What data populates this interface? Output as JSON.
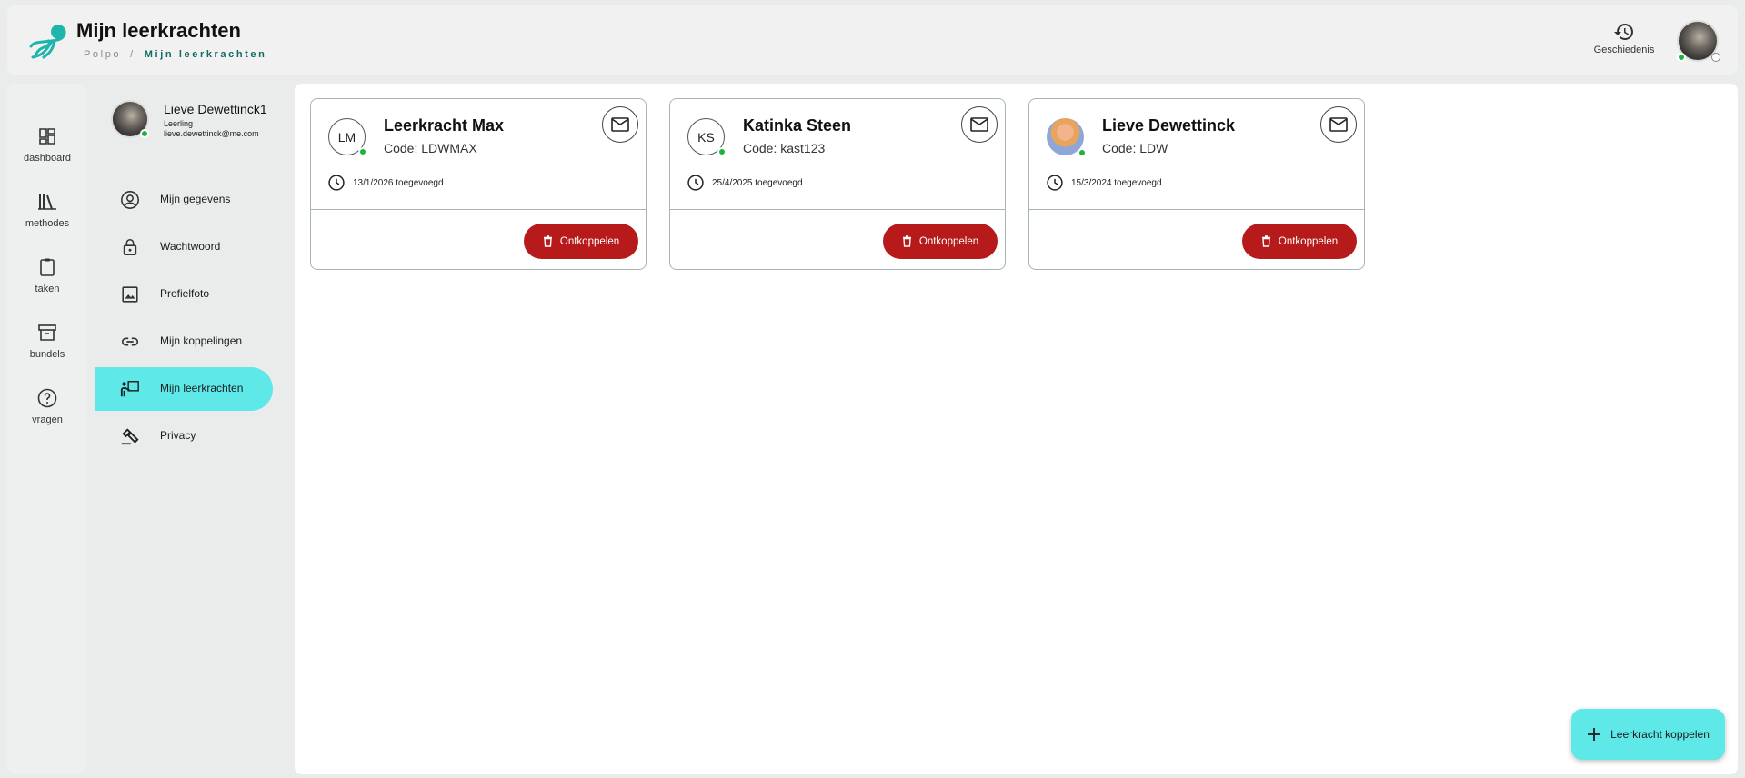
{
  "header": {
    "title": "Mijn leerkrachten",
    "breadcrumb": {
      "root": "Polpo",
      "separator": "/",
      "current": "Mijn leerkrachten"
    },
    "history_label": "Geschiedenis"
  },
  "rail": {
    "items": [
      {
        "label": "dashboard",
        "icon": "dashboard-icon"
      },
      {
        "label": "methodes",
        "icon": "books-icon"
      },
      {
        "label": "taken",
        "icon": "clipboard-icon"
      },
      {
        "label": "bundels",
        "icon": "archive-icon"
      },
      {
        "label": "vragen",
        "icon": "help-icon"
      }
    ]
  },
  "profile": {
    "name": "Lieve Dewettinck1",
    "role": "Leerling",
    "email": "lieve.dewettinck@me.com"
  },
  "menu": {
    "items": [
      {
        "label": "Mijn gegevens",
        "icon": "account-circle-icon"
      },
      {
        "label": "Wachtwoord",
        "icon": "lock-icon"
      },
      {
        "label": "Profielfoto",
        "icon": "image-icon"
      },
      {
        "label": "Mijn koppelingen",
        "icon": "link-icon"
      },
      {
        "label": "Mijn leerkrachten",
        "icon": "teacher-icon",
        "active": true
      },
      {
        "label": "Privacy",
        "icon": "gavel-icon"
      }
    ]
  },
  "teachers": [
    {
      "initials": "LM",
      "name": "Leerkracht Max",
      "code": "Code: LDWMAX",
      "added": "13/1/2026 toegevoegd",
      "unlink_label": "Ontkoppelen"
    },
    {
      "initials": "KS",
      "name": "Katinka Steen",
      "code": "Code: kast123",
      "added": "25/4/2025 toegevoegd",
      "unlink_label": "Ontkoppelen"
    },
    {
      "initials": "",
      "name": "Lieve Dewettinck",
      "code": "Code: LDW",
      "added": "15/3/2024 toegevoegd",
      "unlink_label": "Ontkoppelen"
    }
  ],
  "fab": {
    "label": "Leerkracht koppelen",
    "icon": "plus-icon"
  },
  "colors": {
    "accent": "#5ee8e8",
    "danger": "#b71a1a",
    "online": "#1db33b",
    "brand": "#1fb5ad"
  }
}
